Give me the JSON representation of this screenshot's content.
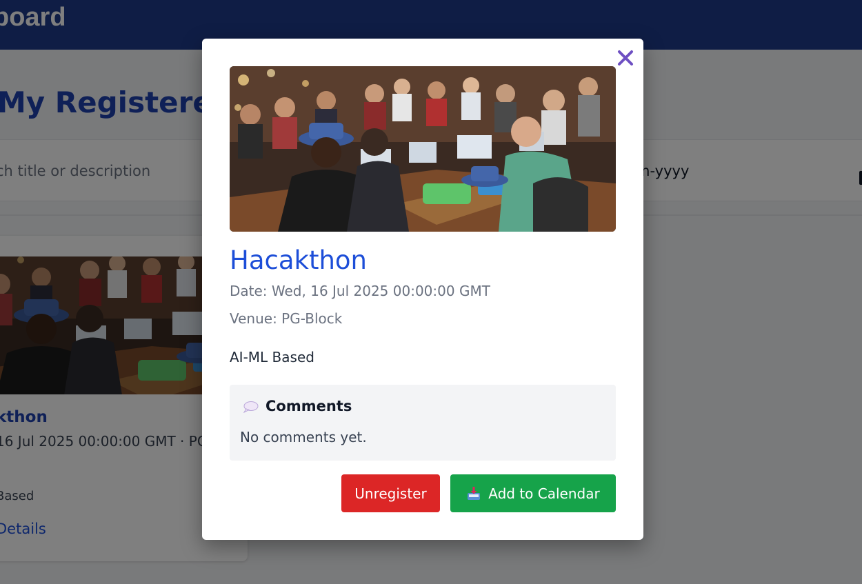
{
  "header": {
    "title": "board"
  },
  "page": {
    "heading": "My Registered"
  },
  "filters": {
    "search_placeholder": "ch title or description",
    "date_placeholder": "m-yyyy"
  },
  "event_card": {
    "title": "kthon",
    "meta": "16 Jul 2025 00:00:00 GMT · PG",
    "description": "Based",
    "details_link": "Details"
  },
  "modal": {
    "title": "Hacakthon",
    "date_text": "Date: Wed, 16 Jul 2025 00:00:00 GMT",
    "venue_text": "Venue: PG-Block",
    "description": "AI-ML Based",
    "comments": {
      "title": "Comments",
      "empty_text": "No comments yet.",
      "icon": "speech-bubble-icon"
    },
    "unregister_label": "Unregister",
    "calendar_label": "Add to Calendar",
    "calendar_icon": "inbox-tray-icon",
    "close_icon": "close-icon"
  },
  "colors": {
    "header_bg": "#1e3a8a",
    "accent": "#1d4ed8",
    "danger": "#dc2626",
    "success": "#16a34a",
    "close_icon": "#6d4fc2"
  }
}
